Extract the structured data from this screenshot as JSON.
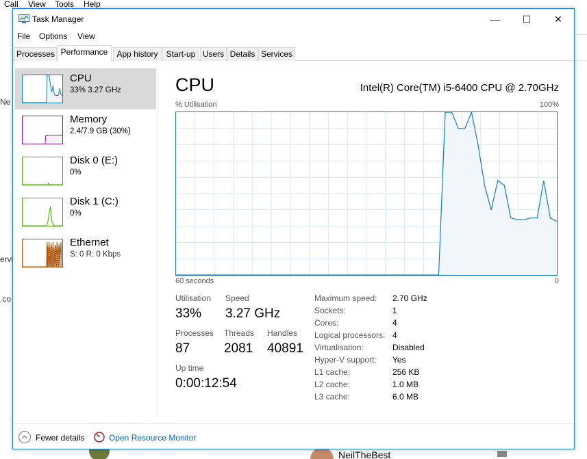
{
  "background": {
    "menu": [
      "Call",
      "View",
      "Tools",
      "Help"
    ],
    "left_fragments": [
      "Ne",
      "ervi",
      ".co"
    ],
    "bottom_name": "NeilTheBest"
  },
  "window": {
    "title": "Task Manager",
    "menu": [
      "File",
      "Options",
      "View"
    ],
    "controls": {
      "minimize": "—",
      "maximize": "☐",
      "close": "✕"
    }
  },
  "tabs": [
    {
      "label": "Processes",
      "active": false
    },
    {
      "label": "Performance",
      "active": true
    },
    {
      "label": "App history",
      "active": false
    },
    {
      "label": "Start-up",
      "active": false
    },
    {
      "label": "Users",
      "active": false
    },
    {
      "label": "Details",
      "active": false
    },
    {
      "label": "Services",
      "active": false
    }
  ],
  "sidebar": [
    {
      "name": "CPU",
      "sub": "33%  3.27 GHz",
      "color": "#117dbb",
      "selected": true
    },
    {
      "name": "Memory",
      "sub": "2.4/7.9 GB (30%)",
      "color": "#8b12ae",
      "selected": false
    },
    {
      "name": "Disk 0 (E:)",
      "sub": "0%",
      "color": "#4da60c",
      "selected": false
    },
    {
      "name": "Disk 1 (C:)",
      "sub": "0%",
      "color": "#4da60c",
      "selected": false
    },
    {
      "name": "Ethernet",
      "sub": "S: 0  R: 0 Kbps",
      "color": "#a74f01",
      "selected": false
    }
  ],
  "main": {
    "title": "CPU",
    "processor": "Intel(R) Core(TM) i5-6400 CPU @ 2.70GHz",
    "graph_label": "% Utilisation",
    "graph_max": "100%",
    "graph_time": "60 seconds",
    "graph_min": "0"
  },
  "chart_data": {
    "type": "area",
    "ylim": [
      0,
      100
    ],
    "values": [
      0,
      0,
      0,
      0,
      0,
      0,
      0,
      0,
      0,
      0,
      0,
      0,
      0,
      0,
      0,
      0,
      0,
      0,
      0,
      0,
      0,
      0,
      0,
      0,
      0,
      0,
      0,
      0,
      0,
      0,
      0,
      0,
      0,
      0,
      0,
      0,
      0,
      0,
      0,
      0,
      0,
      100,
      100,
      90,
      90,
      100,
      80,
      55,
      40,
      58,
      55,
      35,
      34,
      34,
      35,
      35,
      58,
      35,
      33
    ],
    "color": "#117dbb",
    "fill": "#f1f6fa"
  },
  "stats": {
    "utilisation_label": "Utilisation",
    "utilisation": "33%",
    "speed_label": "Speed",
    "speed": "3.27 GHz",
    "processes_label": "Processes",
    "processes": "87",
    "threads_label": "Threads",
    "threads": "2081",
    "handles_label": "Handles",
    "handles": "40891",
    "uptime_label": "Up time",
    "uptime": "0:00:12:54"
  },
  "specs": [
    {
      "label": "Maximum speed:",
      "value": "2.70 GHz"
    },
    {
      "label": "Sockets:",
      "value": "1"
    },
    {
      "label": "Cores:",
      "value": "4"
    },
    {
      "label": "Logical processors:",
      "value": "4"
    },
    {
      "label": "Virtualisation:",
      "value": "Disabled"
    },
    {
      "label": "Hyper-V support:",
      "value": "Yes"
    },
    {
      "label": "L1 cache:",
      "value": "256 KB"
    },
    {
      "label": "L2 cache:",
      "value": "1.0 MB"
    },
    {
      "label": "L3 cache:",
      "value": "6.0 MB"
    }
  ],
  "footer": {
    "fewer_details": "Fewer details",
    "resource_monitor": "Open Resource Monitor"
  }
}
